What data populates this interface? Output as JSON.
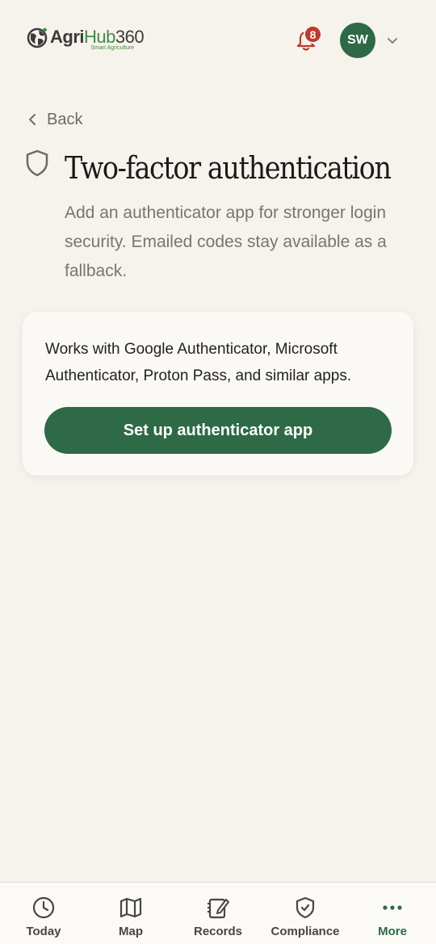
{
  "header": {
    "logo": {
      "word_agri": "Agri",
      "word_hub": "Hub",
      "word_num": "360",
      "tagline": "Smart Agriculture"
    },
    "notifications_count": "8",
    "avatar_initials": "SW"
  },
  "back_label": "Back",
  "page": {
    "title": "Two-factor authentication",
    "subtitle": "Add an authenticator app for stronger login security. Emailed codes stay available as a fallback."
  },
  "card": {
    "description": "Works with Google Authenticator, Microsoft Authenticator, Proton Pass, and similar apps.",
    "button_label": "Set up authenticator app"
  },
  "tabbar": {
    "items": [
      {
        "label": "Today",
        "icon": "clock-icon"
      },
      {
        "label": "Map",
        "icon": "map-icon"
      },
      {
        "label": "Records",
        "icon": "notebook-icon"
      },
      {
        "label": "Compliance",
        "icon": "shield-check-icon"
      },
      {
        "label": "More",
        "icon": "more-dots-icon",
        "active": true
      }
    ]
  },
  "colors": {
    "background": "#f6f3ec",
    "primary_green": "#2d6a45",
    "badge_red": "#c0392b"
  }
}
